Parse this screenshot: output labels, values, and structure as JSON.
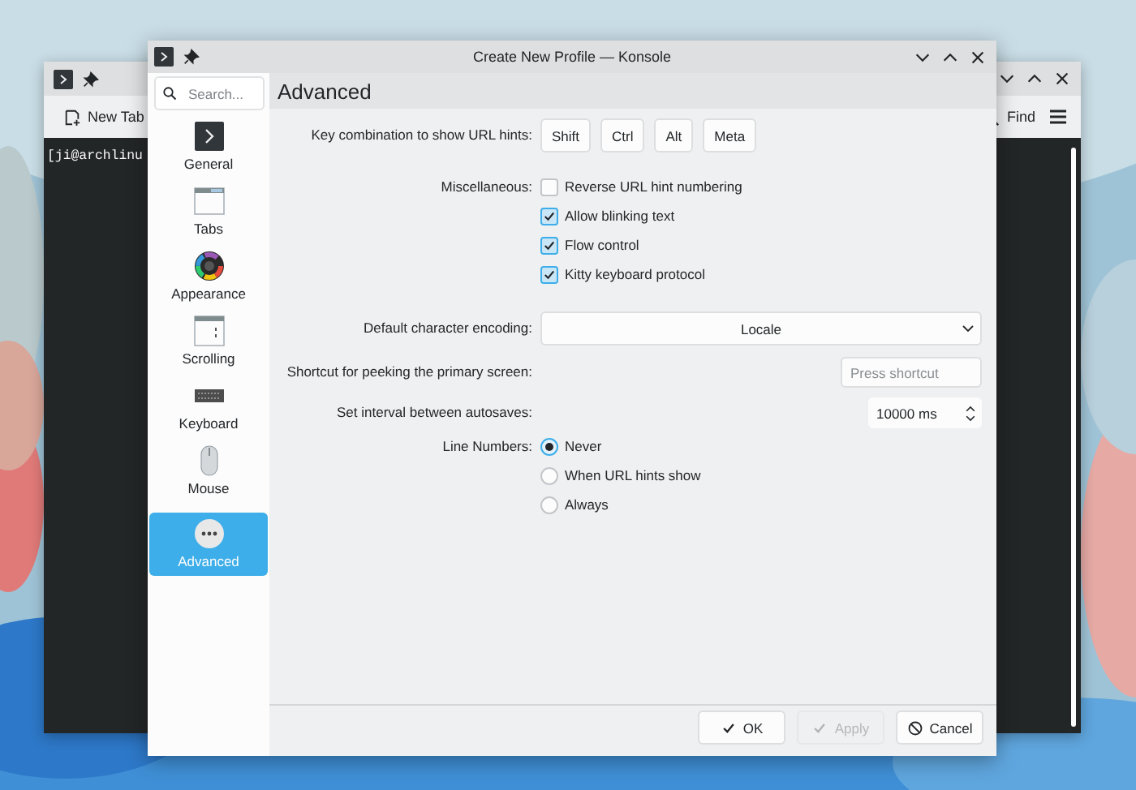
{
  "background_window": {
    "toolbar": {
      "new_tab": "New Tab",
      "find": "Find"
    },
    "terminal_text": "[ji@archlinu"
  },
  "dialog": {
    "title": "Create New Profile — Konsole",
    "search": {
      "placeholder": "Search..."
    },
    "sidebar": {
      "items": [
        {
          "label": "General",
          "selected": false
        },
        {
          "label": "Tabs",
          "selected": false
        },
        {
          "label": "Appearance",
          "selected": false
        },
        {
          "label": "Scrolling",
          "selected": false
        },
        {
          "label": "Keyboard",
          "selected": false
        },
        {
          "label": "Mouse",
          "selected": false
        },
        {
          "label": "Advanced",
          "selected": true
        }
      ]
    },
    "page_title": "Advanced",
    "form": {
      "rows": [
        {
          "kind": "keys",
          "label": "Key combination to show URL hints:",
          "keys": [
            "Shift",
            "Ctrl",
            "Alt",
            "Meta"
          ]
        },
        {
          "kind": "checks",
          "label": "Miscellaneous:",
          "options": [
            {
              "label": "Reverse URL hint numbering",
              "checked": false
            },
            {
              "label": "Allow blinking text",
              "checked": true
            },
            {
              "label": "Flow control",
              "checked": true
            },
            {
              "label": "Kitty keyboard protocol",
              "checked": true
            }
          ]
        },
        {
          "kind": "combo",
          "label": "Default character encoding:",
          "value": "Locale"
        },
        {
          "kind": "shortcut",
          "label": "Shortcut for peeking the primary screen:",
          "placeholder": "Press shortcut"
        },
        {
          "kind": "spin",
          "label": "Set interval between autosaves:",
          "value": "10000 ms"
        },
        {
          "kind": "radios",
          "label": "Line Numbers:",
          "options": [
            {
              "label": "Never",
              "selected": true
            },
            {
              "label": "When URL hints show",
              "selected": false
            },
            {
              "label": "Always",
              "selected": false
            }
          ]
        }
      ]
    },
    "buttons": [
      {
        "label": "OK",
        "disabled": false
      },
      {
        "label": "Apply",
        "disabled": true
      },
      {
        "label": "Cancel",
        "disabled": false
      }
    ]
  }
}
